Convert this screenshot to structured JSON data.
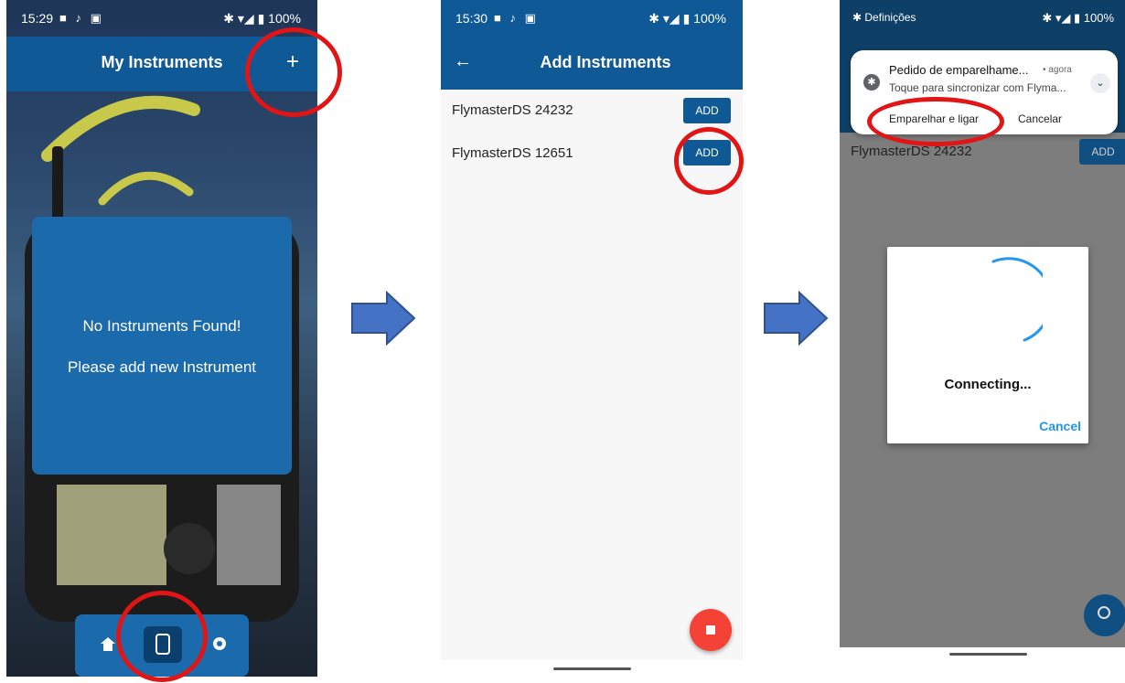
{
  "screen1": {
    "status": {
      "time": "15:29",
      "icons": "■ ♪ ▣",
      "right": "✱ ▾◢ ▮ 100%"
    },
    "appbar": {
      "title": "My Instruments",
      "add_label": "+"
    },
    "dialog": {
      "line1": "No Instruments Found!",
      "line2": "Please add new Instrument"
    },
    "nav": [
      "home",
      "instruments",
      "settings"
    ]
  },
  "screen2": {
    "status": {
      "time": "15:30",
      "icons": "■ ♪ ▣",
      "right": "✱ ▾◢ ▮ 100%"
    },
    "appbar": {
      "title": "Add Instruments",
      "back_label": "←"
    },
    "devices": [
      {
        "name": "FlymasterDS 24232",
        "button": "ADD"
      },
      {
        "name": "FlymasterDS 12651",
        "button": "ADD"
      }
    ]
  },
  "screen3": {
    "status": {
      "left": "✱ Definições",
      "right": "✱ ▾◢ ▮ 100%"
    },
    "notification": {
      "title": "Pedido de emparelhame...",
      "time": "• agora",
      "text": "Toque para sincronizar com Flyma...",
      "action_primary": "Emparelhar e ligar",
      "action_secondary": "Cancelar"
    },
    "background_device": {
      "name": "FlymasterDS 24232",
      "button": "ADD"
    },
    "dialog": {
      "message": "Connecting...",
      "cancel": "Cancel"
    }
  },
  "colors": {
    "brand": "#0f5a96",
    "highlight": "#e11515",
    "arrow": "#4472c4",
    "fab": "#f44336"
  }
}
